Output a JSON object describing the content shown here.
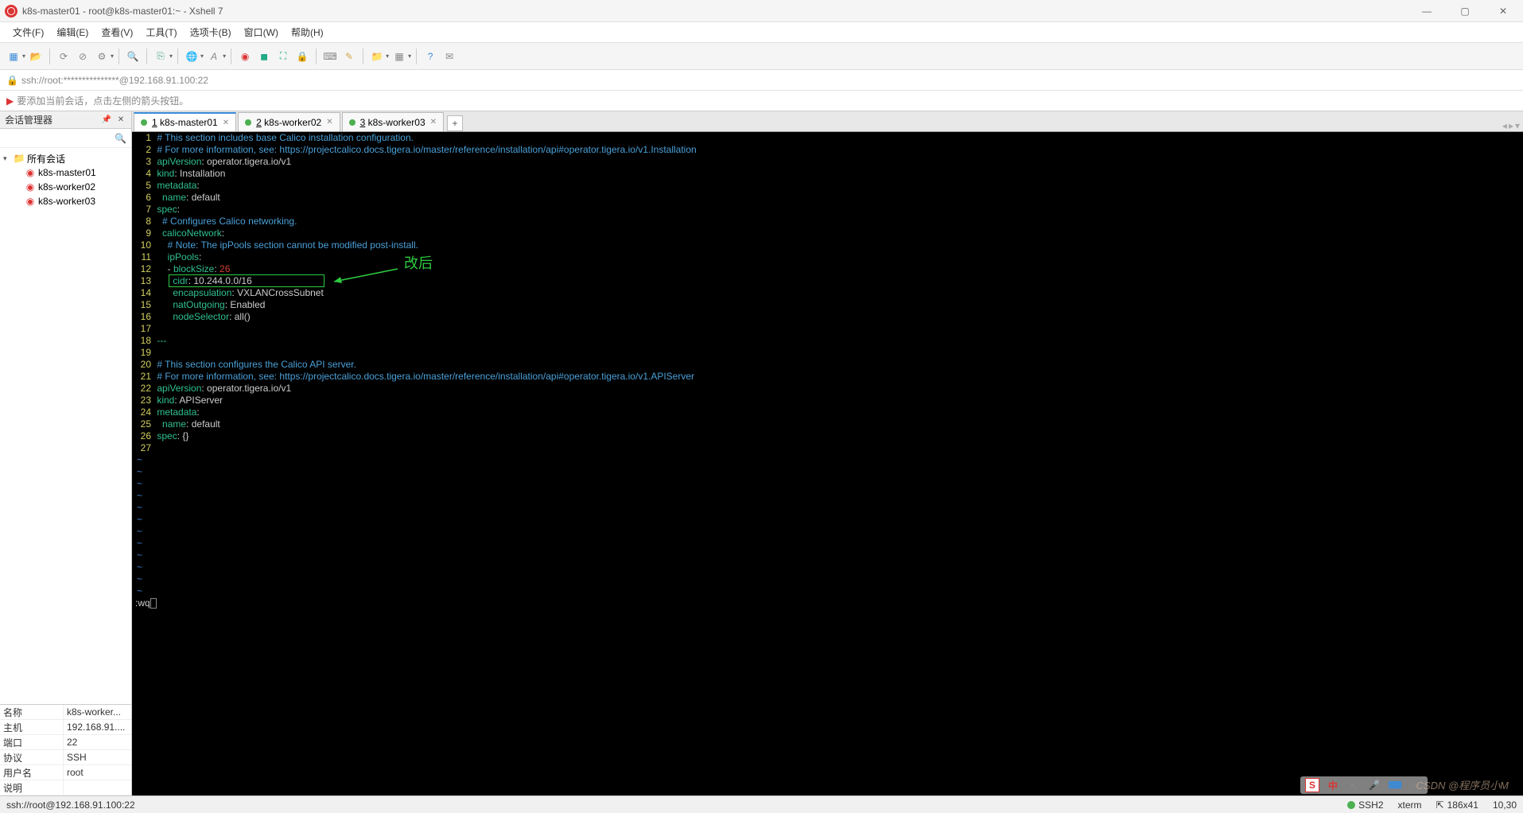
{
  "title": "k8s-master01 - root@k8s-master01:~ - Xshell 7",
  "menu": [
    "文件(F)",
    "编辑(E)",
    "查看(V)",
    "工具(T)",
    "选项卡(B)",
    "窗口(W)",
    "帮助(H)"
  ],
  "addr_url": "ssh://root:***************@192.168.91.100:22",
  "hint_text": "要添加当前会话，点击左侧的箭头按钮。",
  "sidebar": {
    "title": "会话管理器",
    "root": "所有会话",
    "items": [
      "k8s-master01",
      "k8s-worker02",
      "k8s-worker03"
    ]
  },
  "props": [
    {
      "label": "名称",
      "value": "k8s-worker..."
    },
    {
      "label": "主机",
      "value": "192.168.91...."
    },
    {
      "label": "端口",
      "value": "22"
    },
    {
      "label": "协议",
      "value": "SSH"
    },
    {
      "label": "用户名",
      "value": "root"
    },
    {
      "label": "说明",
      "value": ""
    }
  ],
  "tabs": [
    {
      "num": "1",
      "label": "k8s-master01",
      "active": true
    },
    {
      "num": "2",
      "label": "k8s-worker02",
      "active": false
    },
    {
      "num": "3",
      "label": "k8s-worker03",
      "active": false
    }
  ],
  "annotation": "改后",
  "cmdline": ":wq",
  "code_lines": [
    {
      "n": 1,
      "seg": [
        [
          "c-cmt",
          "# This section includes base Calico installation configuration."
        ]
      ]
    },
    {
      "n": 2,
      "seg": [
        [
          "c-cmt",
          "# For more information, see: https://projectcalico.docs.tigera.io/master/reference/installation/api#operator.tigera.io/v1.Installation"
        ]
      ]
    },
    {
      "n": 3,
      "seg": [
        [
          "c-key",
          "apiVersion"
        ],
        [
          "",
          ": operator.tigera.io/v1"
        ]
      ]
    },
    {
      "n": 4,
      "seg": [
        [
          "c-key",
          "kind"
        ],
        [
          "",
          ": Installation"
        ]
      ]
    },
    {
      "n": 5,
      "seg": [
        [
          "c-key",
          "metadata"
        ],
        [
          "",
          ":"
        ]
      ]
    },
    {
      "n": 6,
      "seg": [
        [
          "",
          "  "
        ],
        [
          "c-key",
          "name"
        ],
        [
          "",
          ": default"
        ]
      ]
    },
    {
      "n": 7,
      "seg": [
        [
          "c-key",
          "spec"
        ],
        [
          "",
          ":"
        ]
      ]
    },
    {
      "n": 8,
      "seg": [
        [
          "",
          "  "
        ],
        [
          "c-cmt",
          "# Configures Calico networking."
        ]
      ]
    },
    {
      "n": 9,
      "seg": [
        [
          "",
          "  "
        ],
        [
          "c-key",
          "calicoNetwork"
        ],
        [
          "",
          ":"
        ]
      ]
    },
    {
      "n": 10,
      "seg": [
        [
          "",
          "    "
        ],
        [
          "c-cmt",
          "# Note: The ipPools section cannot be modified post-install."
        ]
      ]
    },
    {
      "n": 11,
      "seg": [
        [
          "",
          "    "
        ],
        [
          "c-key",
          "ipPools"
        ],
        [
          "",
          ":"
        ]
      ]
    },
    {
      "n": 12,
      "seg": [
        [
          "",
          "    - "
        ],
        [
          "c-key",
          "blockSize"
        ],
        [
          "",
          ": "
        ],
        [
          "c-num",
          "26"
        ]
      ]
    },
    {
      "n": 13,
      "seg": [
        [
          "",
          "      "
        ],
        [
          "c-key",
          "cidr"
        ],
        [
          "",
          ": 10.244.0.0/16"
        ]
      ]
    },
    {
      "n": 14,
      "seg": [
        [
          "",
          "      "
        ],
        [
          "c-key",
          "encapsulation"
        ],
        [
          "",
          ": VXLANCrossSubnet"
        ]
      ]
    },
    {
      "n": 15,
      "seg": [
        [
          "",
          "      "
        ],
        [
          "c-key",
          "natOutgoing"
        ],
        [
          "",
          ": Enabled"
        ]
      ]
    },
    {
      "n": 16,
      "seg": [
        [
          "",
          "      "
        ],
        [
          "c-key",
          "nodeSelector"
        ],
        [
          "",
          ": all()"
        ]
      ]
    },
    {
      "n": 17,
      "seg": []
    },
    {
      "n": 18,
      "seg": [
        [
          "c-key",
          "---"
        ]
      ]
    },
    {
      "n": 19,
      "seg": []
    },
    {
      "n": 20,
      "seg": [
        [
          "c-cmt",
          "# This section configures the Calico API server."
        ]
      ]
    },
    {
      "n": 21,
      "seg": [
        [
          "c-cmt",
          "# For more information, see: https://projectcalico.docs.tigera.io/master/reference/installation/api#operator.tigera.io/v1.APIServer"
        ]
      ]
    },
    {
      "n": 22,
      "seg": [
        [
          "c-key",
          "apiVersion"
        ],
        [
          "",
          ": operator.tigera.io/v1"
        ]
      ]
    },
    {
      "n": 23,
      "seg": [
        [
          "c-key",
          "kind"
        ],
        [
          "",
          ": APIServer"
        ]
      ]
    },
    {
      "n": 24,
      "seg": [
        [
          "c-key",
          "metadata"
        ],
        [
          "",
          ":"
        ]
      ]
    },
    {
      "n": 25,
      "seg": [
        [
          "",
          "  "
        ],
        [
          "c-key",
          "name"
        ],
        [
          "",
          ": default"
        ]
      ]
    },
    {
      "n": 26,
      "seg": [
        [
          "c-key",
          "spec"
        ],
        [
          "",
          ": "
        ],
        [
          "",
          "{}"
        ]
      ]
    },
    {
      "n": 27,
      "seg": []
    }
  ],
  "status": {
    "left": "ssh://root@192.168.91.100:22",
    "ssh": "SSH2",
    "term": "xterm",
    "size": "186x41",
    "extra": "10,30"
  },
  "watermark": "CSDN @程序员小M"
}
